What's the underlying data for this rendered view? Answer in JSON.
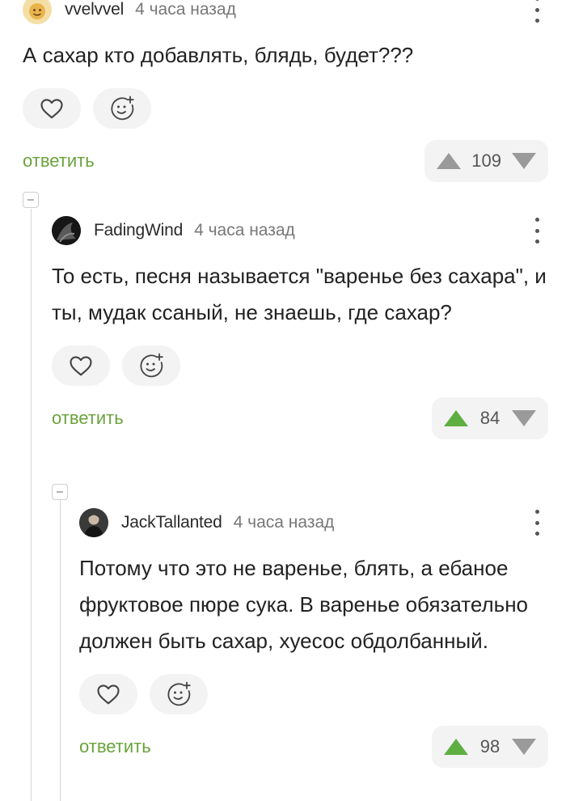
{
  "comments": [
    {
      "author": "vvelvvel",
      "time": "4 часа назад",
      "text": "А сахар кто добавлять, блядь, будет???",
      "reply_label": "ответить",
      "rating": "109",
      "upvoted": false
    },
    {
      "author": "FadingWind",
      "time": "4 часа назад",
      "text": "То есть, песня называется \"варенье без сахара\", и ты, мудак ссаный, не знаешь, где сахар?",
      "reply_label": "ответить",
      "rating": "84",
      "upvoted": true
    },
    {
      "author": "JackTallanted",
      "time": "4 часа назад",
      "text": "Потому что это не варенье, блять, а ебаное фруктовое пюре сука. В варенье обязательно должен быть сахар, хуесос обдолбанный.",
      "reply_label": "ответить",
      "rating": "98",
      "upvoted": true
    }
  ],
  "colors": {
    "upvote_active": "#5fae42",
    "vote_inactive": "#9a9a9a",
    "reply": "#6aa33c"
  },
  "icons": [
    "heart-icon",
    "add-emoji-icon",
    "upvote-arrow-icon",
    "downvote-arrow-icon",
    "more-icon",
    "collapse-icon"
  ]
}
